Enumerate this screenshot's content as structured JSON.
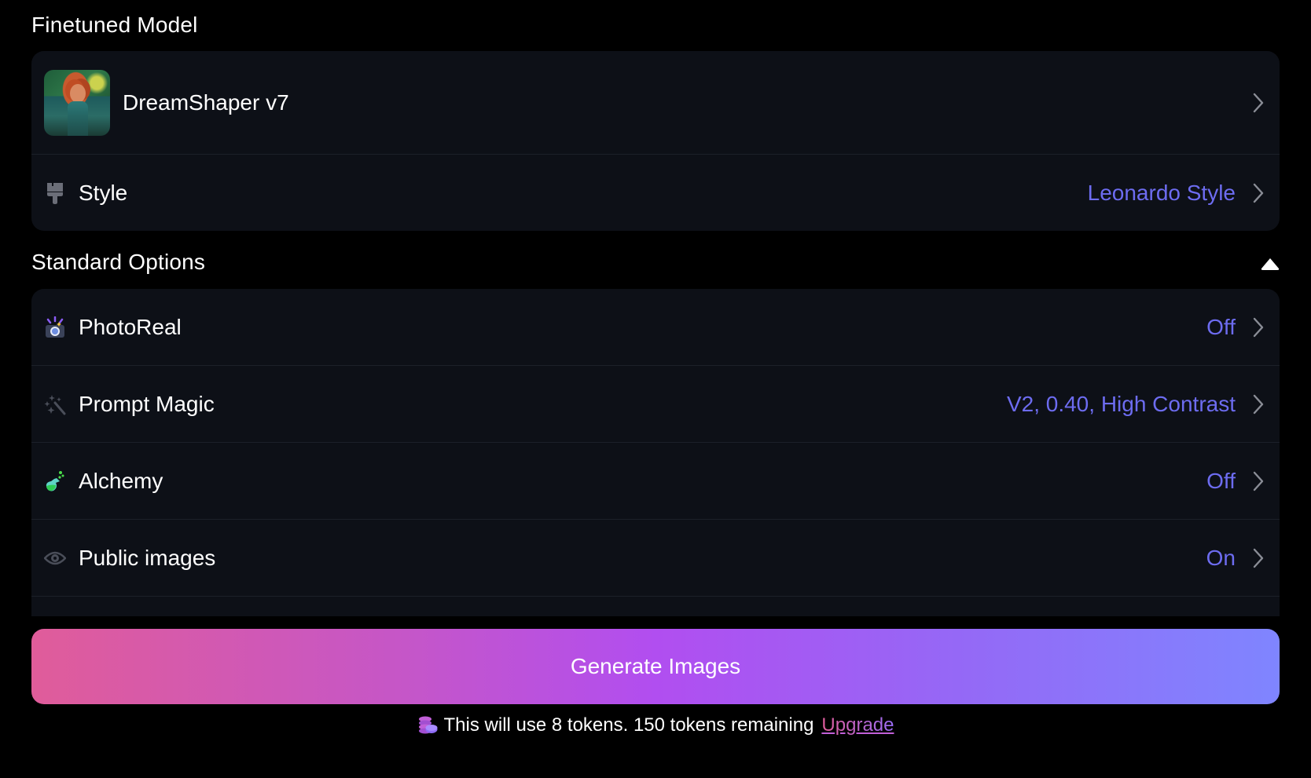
{
  "sections": {
    "finetuned_title": "Finetuned Model",
    "standard_title": "Standard Options"
  },
  "model": {
    "name": "DreamShaper v7",
    "thumbnail_icon": "model-thumbnail"
  },
  "style": {
    "label": "Style",
    "value": "Leonardo Style",
    "icon": "paintbrush-icon"
  },
  "options": [
    {
      "label": "PhotoReal",
      "value": "Off",
      "icon": "camera-flash-icon"
    },
    {
      "label": "Prompt Magic",
      "value": "V2, 0.40, High Contrast",
      "icon": "magic-wand-icon"
    },
    {
      "label": "Alchemy",
      "value": "Off",
      "icon": "potion-flask-icon"
    },
    {
      "label": "Public images",
      "value": "On",
      "icon": "eye-icon"
    }
  ],
  "generate": {
    "label": "Generate Images"
  },
  "tokens": {
    "message": "This will use 8 tokens. 150 tokens remaining",
    "upgrade_label": "Upgrade",
    "cost": 8,
    "remaining": 150
  },
  "colors": {
    "accent_value": "#6d6cf0",
    "card_bg": "#0d1017",
    "button_gradient_start": "#e05c9a",
    "button_gradient_mid": "#b14ef0",
    "button_gradient_end": "#7f85ff"
  }
}
